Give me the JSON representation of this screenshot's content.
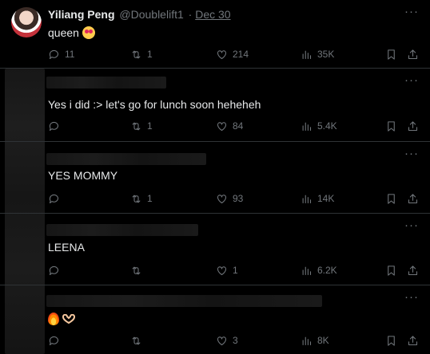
{
  "main_tweet": {
    "author_name": "Yiliang Peng",
    "author_handle": "@Doublelift1",
    "separator": "·",
    "date": "Dec 30",
    "text": "queen",
    "emoji": "heart-eyes-emoji",
    "more": "···",
    "stats": {
      "replies": "11",
      "retweets": "1",
      "likes": "214",
      "views": "35K"
    }
  },
  "replies": [
    {
      "text": "Yes i did :> let's go for lunch soon heheheh",
      "more": "···",
      "stats": {
        "replies": "",
        "retweets": "1",
        "likes": "84",
        "views": "5.4K"
      }
    },
    {
      "text": "YES MOMMY",
      "more": "···",
      "stats": {
        "replies": "",
        "retweets": "1",
        "likes": "93",
        "views": "14K"
      }
    },
    {
      "text": "LEENA",
      "more": "···",
      "stats": {
        "replies": "",
        "retweets": "",
        "likes": "1",
        "views": "6.2K"
      }
    },
    {
      "text": "",
      "emoji": [
        "fire-emoji",
        "heart-hands-emoji"
      ],
      "more": "···",
      "stats": {
        "replies": "",
        "retweets": "",
        "likes": "3",
        "views": "8K"
      }
    }
  ],
  "colors": {
    "background": "#000000",
    "text": "#e7e9ea",
    "muted": "#71767b",
    "divider": "#2f3336"
  }
}
